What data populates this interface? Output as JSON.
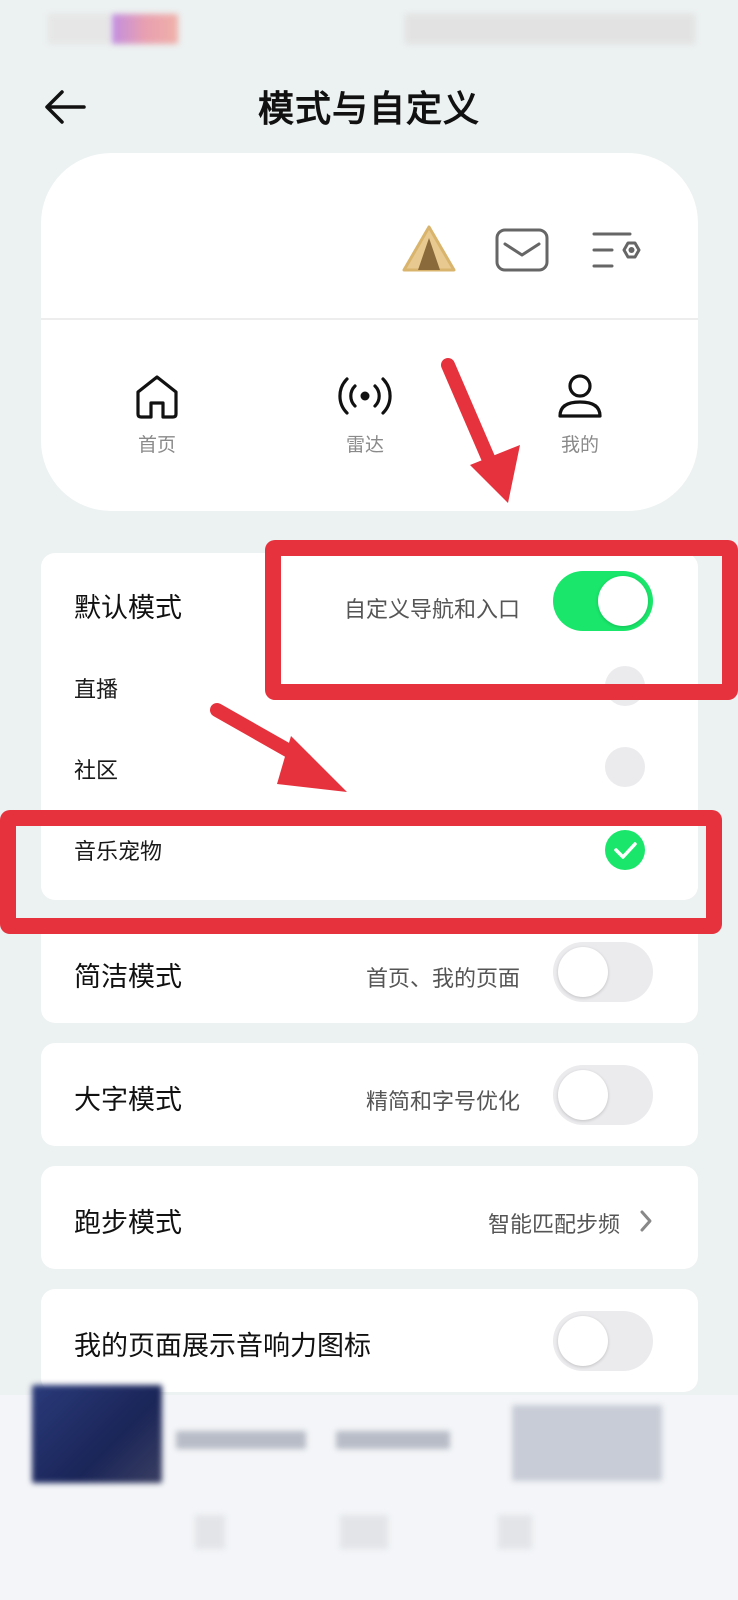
{
  "header": {
    "title": "模式与自定义"
  },
  "preview": {
    "top_icons": [
      "tent-icon",
      "mail-icon",
      "settings-list-icon"
    ],
    "nav": [
      {
        "label": "首页",
        "icon": "home-icon"
      },
      {
        "label": "雷达",
        "icon": "radar-icon"
      },
      {
        "label": "我的",
        "icon": "user-icon"
      }
    ]
  },
  "default_mode": {
    "label": "默认模式",
    "desc": "自定义导航和入口",
    "toggle_on": true,
    "options": [
      {
        "label": "直播",
        "checked": false
      },
      {
        "label": "社区",
        "checked": false
      },
      {
        "label": "音乐宠物",
        "checked": true
      }
    ]
  },
  "simple_mode": {
    "label": "简洁模式",
    "desc": "首页、我的页面",
    "toggle_on": false
  },
  "large_font_mode": {
    "label": "大字模式",
    "desc": "精简和字号优化",
    "toggle_on": false
  },
  "running_mode": {
    "label": "跑步模式",
    "desc": "智能匹配步频"
  },
  "show_icon": {
    "label": "我的页面展示音响力图标",
    "toggle_on": false
  },
  "colors": {
    "accent_green": "#19e66a",
    "annotation_red": "#e5323d",
    "page_bg": "#ecf1f1"
  }
}
